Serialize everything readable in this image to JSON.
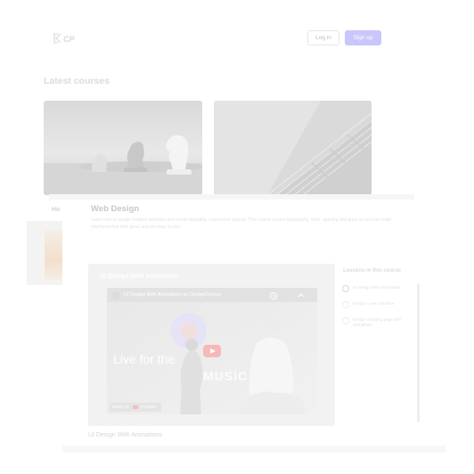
{
  "header": {
    "logo_text": "CP",
    "login_label": "Log in",
    "signup_label": "Sign up"
  },
  "latest": {
    "title": "Latest courses"
  },
  "background_page": {
    "left_label": "Ho",
    "course_title": "Web Design",
    "course_description": "Learn how to design modern websites and create beautiful, responsive layouts. This course covers typography, color, spacing and grids so you can build interfaces that look great and are easy to use."
  },
  "video": {
    "frame_title": "UI Design With Animations",
    "player_title": "UI Design With Animations by DesignCourse",
    "hero_text": "Live for the",
    "music_text": "MUSIC",
    "watch_on_label": "Watch on",
    "watch_on_brand": "YouTube",
    "caption": "UI Design With Animations"
  },
  "lessons": {
    "heading": "Lessons in this course",
    "items": [
      {
        "label": "UI Design With Animations",
        "state": "active"
      },
      {
        "label": "Design a user interface",
        "state": "default"
      },
      {
        "label": "Design a landing page with animations",
        "state": "default"
      }
    ]
  },
  "colors": {
    "accent": "#c9c6fb",
    "frame": "#f2f2f2",
    "youtube_red": "#f7b8b8"
  }
}
